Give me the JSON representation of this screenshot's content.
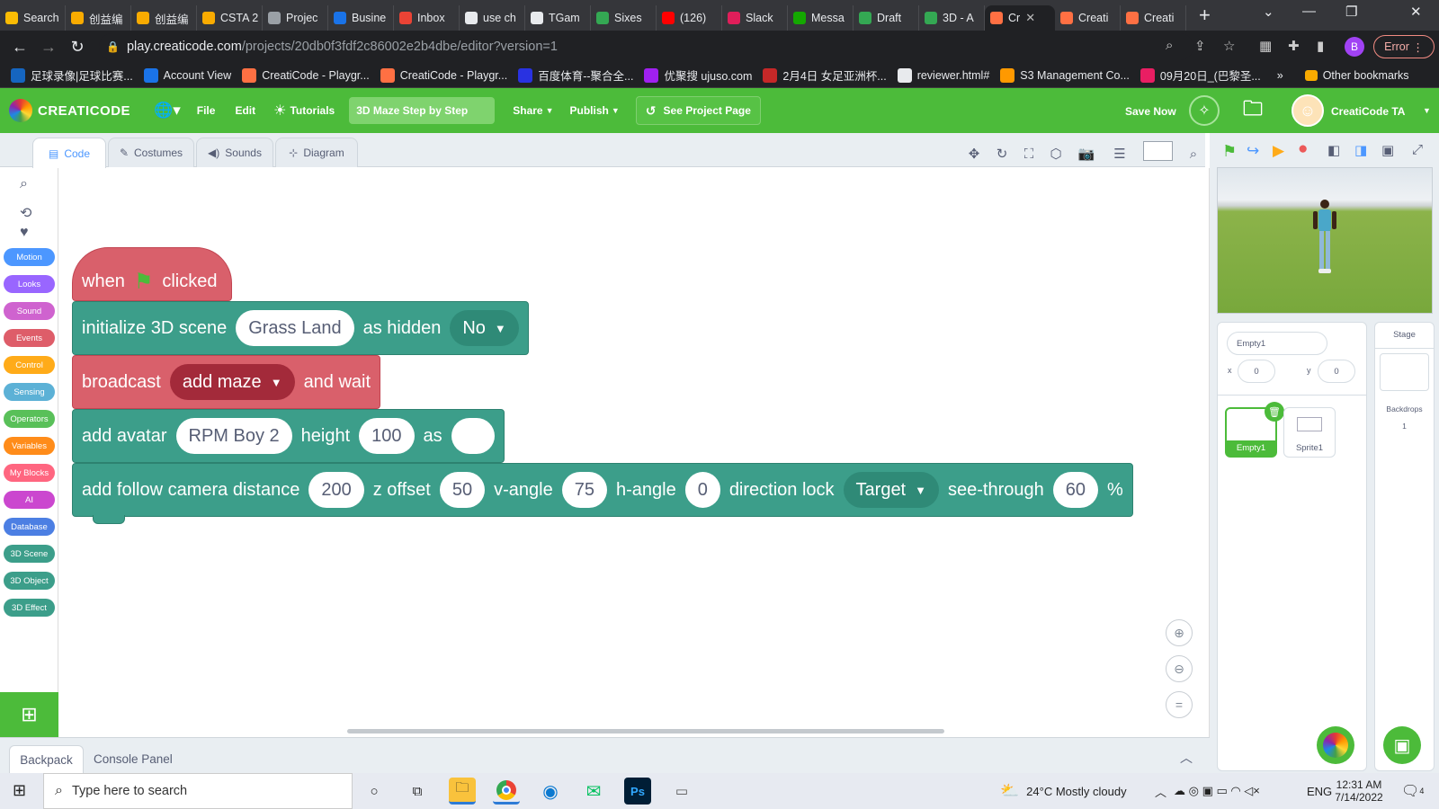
{
  "browser": {
    "tabs": [
      {
        "label": "Search",
        "color": "#fbbc04"
      },
      {
        "label": "创益编",
        "color": "#f9ab00"
      },
      {
        "label": "创益编",
        "color": "#f9ab00"
      },
      {
        "label": "CSTA 2",
        "color": "#f9ab00"
      },
      {
        "label": "Projec",
        "color": "#9aa0a6"
      },
      {
        "label": "Busine",
        "color": "#1a73e8"
      },
      {
        "label": "Inbox",
        "color": "#ea4335"
      },
      {
        "label": "use ch",
        "color": "#e8eaed"
      },
      {
        "label": "TGam",
        "color": "#e8eaed"
      },
      {
        "label": "Sixes",
        "color": "#34a853"
      },
      {
        "label": "(126)",
        "color": "#ff0000"
      },
      {
        "label": "Slack",
        "color": "#e01e5a"
      },
      {
        "label": "Messa",
        "color": "#14a800"
      },
      {
        "label": "Draft",
        "color": "#34a853"
      },
      {
        "label": "3D - A",
        "color": "#34a853"
      },
      {
        "label": "Cr",
        "color": "#ff7043",
        "active": true
      },
      {
        "label": "Creati",
        "color": "#ff7043"
      },
      {
        "label": "Creati",
        "color": "#ff7043"
      }
    ],
    "new_tab": "+",
    "url_host": "play.creaticode.com",
    "url_path": "/projects/20db0f3fdf2c86002e2b4dbe/editor?version=1",
    "profile_initial": "B",
    "error_label": "Error",
    "bookmarks": [
      {
        "label": "足球录像|足球比赛...",
        "color": "#1565c0"
      },
      {
        "label": "Account View",
        "color": "#1a73e8"
      },
      {
        "label": "CreatiCode - Playgr...",
        "color": "#ff7043"
      },
      {
        "label": "CreatiCode - Playgr...",
        "color": "#ff7043"
      },
      {
        "label": "百度体育--聚合全...",
        "color": "#2932e1"
      },
      {
        "label": "优聚搜 ujuso.com",
        "color": "#a020f0"
      },
      {
        "label": "2月4日 女足亚洲杯...",
        "color": "#c62828"
      },
      {
        "label": "reviewer.html#",
        "color": "#e8eaed"
      },
      {
        "label": "S3 Management Co...",
        "color": "#ff9900"
      },
      {
        "label": "09月20日_(巴黎圣...",
        "color": "#e91e63"
      }
    ],
    "bookmarks_more": "»",
    "other_bookmarks": "Other bookmarks"
  },
  "app": {
    "logo_text": "CREATICODE",
    "menu_file": "File",
    "menu_edit": "Edit",
    "menu_tutorials": "Tutorials",
    "project_title": "3D Maze Step by Step",
    "menu_share": "Share",
    "menu_publish": "Publish",
    "see_project_page": "See Project Page",
    "save_now": "Save Now",
    "user_name": "CreatiCode TA"
  },
  "editor_tabs": [
    "Code",
    "Costumes",
    "Sounds",
    "Diagram"
  ],
  "categories": [
    {
      "label": "Motion",
      "color": "#4c97ff"
    },
    {
      "label": "Looks",
      "color": "#9966ff"
    },
    {
      "label": "Sound",
      "color": "#cf63cf"
    },
    {
      "label": "Events",
      "color": "#de5d69"
    },
    {
      "label": "Control",
      "color": "#ffab19"
    },
    {
      "label": "Sensing",
      "color": "#5cb1d6"
    },
    {
      "label": "Operators",
      "color": "#59c059"
    },
    {
      "label": "Variables",
      "color": "#ff8c1a"
    },
    {
      "label": "My Blocks",
      "color": "#ff6680"
    },
    {
      "label": "AI",
      "color": "#cb47cf"
    },
    {
      "label": "Database",
      "color": "#4c7fe3"
    },
    {
      "label": "3D Scene",
      "color": "#3c9e8a"
    },
    {
      "label": "3D Object",
      "color": "#3c9e8a"
    },
    {
      "label": "3D Effect",
      "color": "#3c9e8a"
    }
  ],
  "blocks": {
    "hat": {
      "when": "when",
      "clicked": "clicked"
    },
    "init": {
      "text1": "initialize 3D scene",
      "scene": "Grass Land",
      "text2": "as hidden",
      "hidden": "No"
    },
    "broadcast": {
      "text1": "broadcast",
      "message": "add maze",
      "text2": "and wait"
    },
    "avatar": {
      "text1": "add avatar",
      "name": "RPM Boy 2",
      "text2": "height",
      "height": "100",
      "text3": "as",
      "as_value": ""
    },
    "camera": {
      "text1": "add follow camera distance",
      "distance": "200",
      "text2": "z offset",
      "z_offset": "50",
      "text3": "v-angle",
      "v_angle": "75",
      "text4": "h-angle",
      "h_angle": "0",
      "text5": "direction lock",
      "lock": "Target",
      "text6": "see-through",
      "see_through": "60",
      "text7": "%"
    }
  },
  "sprite_panel": {
    "sprite_name": "Empty1",
    "x_label": "x",
    "x_value": "0",
    "y_label": "y",
    "y_value": "0",
    "sprites": [
      "Empty1",
      "Sprite1"
    ],
    "stage_label": "Stage",
    "backdrops_label": "Backdrops",
    "backdrops_count": "1"
  },
  "bottom": {
    "backpack": "Backpack",
    "console": "Console Panel"
  },
  "taskbar": {
    "search_placeholder": "Type here to search",
    "weather": "24°C  Mostly cloudy",
    "lang": "ENG",
    "time": "12:31 AM",
    "date": "7/14/2022",
    "notifications": "4"
  }
}
